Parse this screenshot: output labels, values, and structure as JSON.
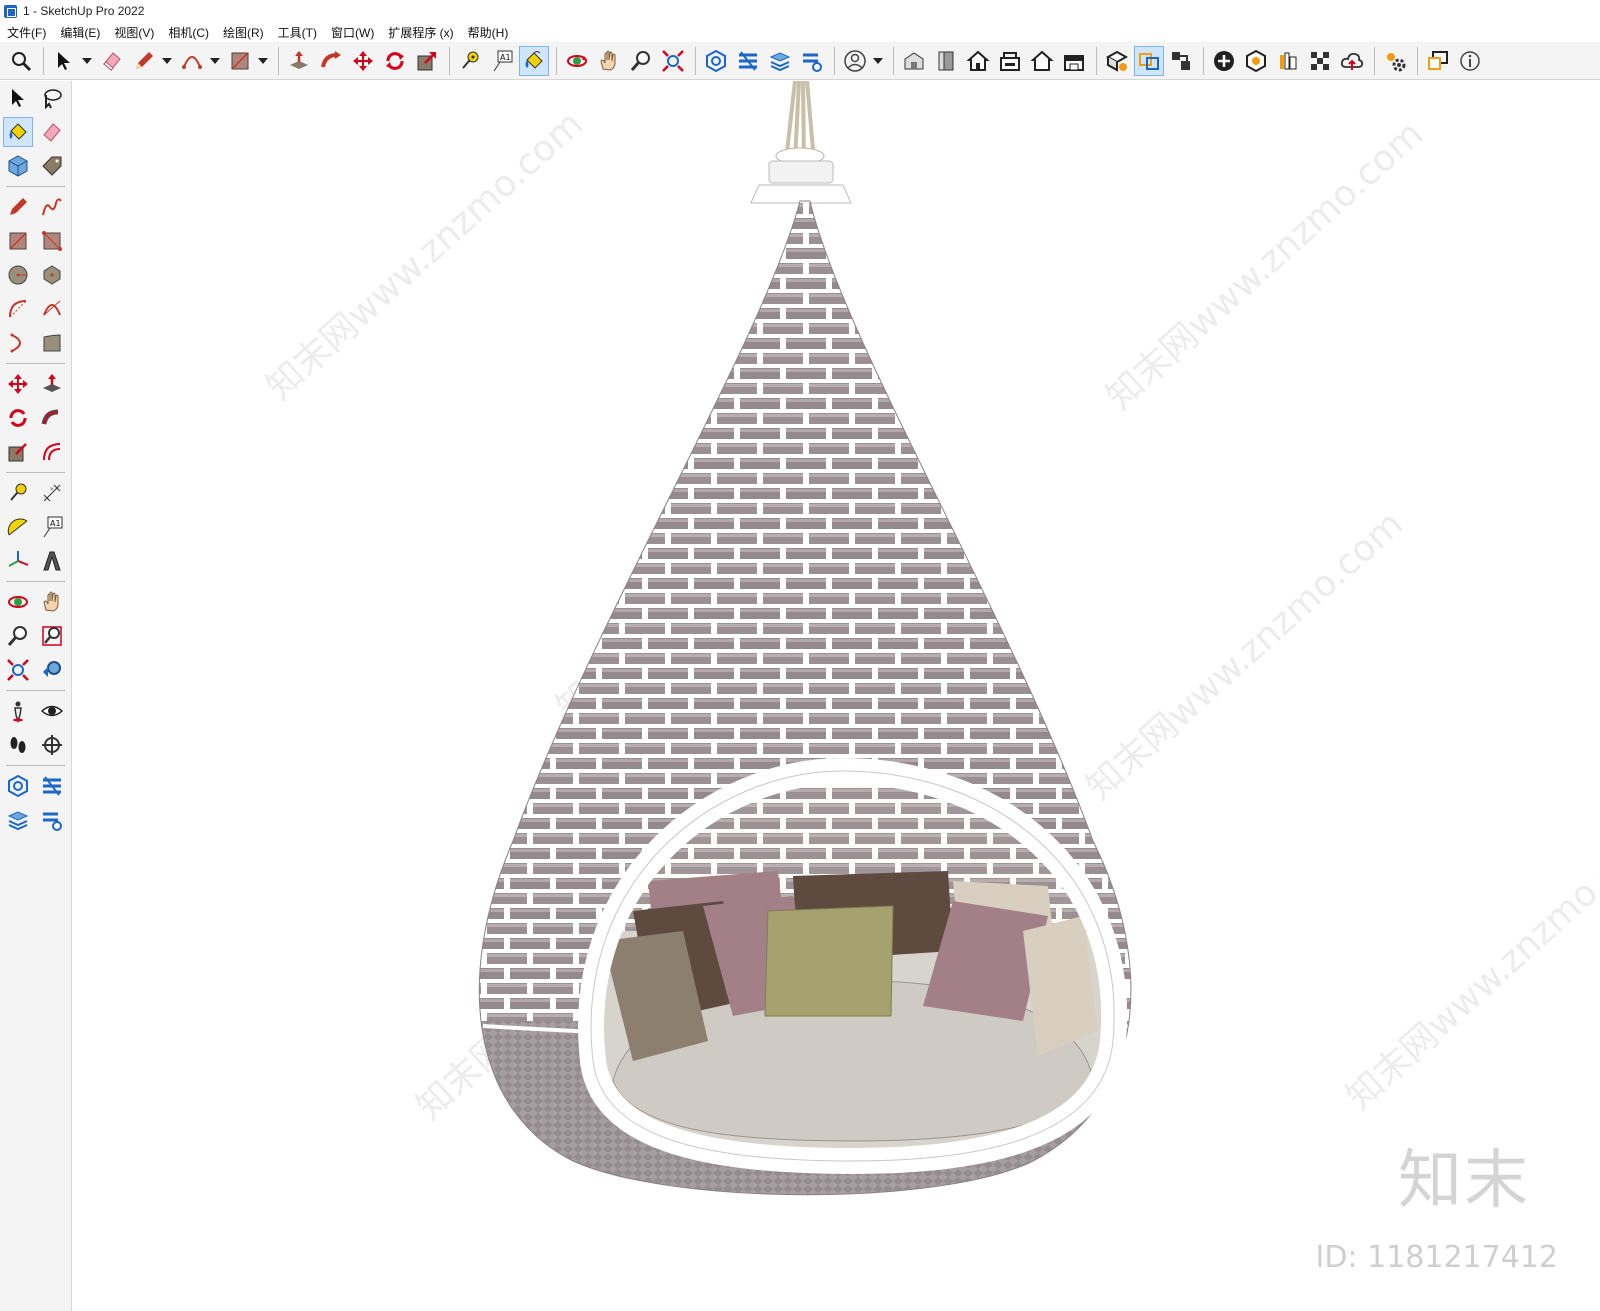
{
  "window": {
    "title": "1 - SketchUp Pro 2022"
  },
  "menu": [
    "文件(F)",
    "编辑(E)",
    "视图(V)",
    "相机(C)",
    "绘图(R)",
    "工具(T)",
    "窗口(W)",
    "扩展程序 (x)",
    "帮助(H)"
  ],
  "toolbar": {
    "text_tool_glyph": "A1",
    "tools": [
      "search-icon",
      "select-icon",
      "eraser-icon",
      "pencil-icon",
      "arc-icon",
      "rectangle-icon",
      "push-pull-icon",
      "follow-me-icon",
      "move-icon",
      "rotate-icon",
      "scale-icon",
      "tape-measure-icon",
      "text-icon",
      "paint-bucket-icon",
      "orbit-icon",
      "pan-icon",
      "zoom-icon",
      "zoom-extents-icon",
      "warehouse-icon",
      "extension-warehouse-icon",
      "layout-icon",
      "extension-manager-icon",
      "account-icon",
      "iso-view-icon",
      "front-view-icon",
      "top-view-icon",
      "right-view-icon",
      "back-view-icon",
      "left-view-icon",
      "section-plane-icon",
      "display-section-icon",
      "section-cuts-icon",
      "solid-tool-icon",
      "outer-shell-icon",
      "styles-icon",
      "xray-icon",
      "cloud-icon",
      "settings-icon",
      "dialog-icon",
      "info-icon"
    ],
    "active_tool": "paint-bucket-icon"
  },
  "palette": {
    "text_tool_glyph": "A1",
    "active_tool": "paint-bucket-icon"
  },
  "viewport": {
    "model": "hanging-pod-chair",
    "watermark_logo": "知末",
    "watermark_id": "ID: 1181217412",
    "watermark_text": "知末网www.znzmo.com"
  },
  "colors": {
    "weave": "#9a8f93",
    "weave_light": "#b8adb0",
    "rim": "#ffffff",
    "cushion_base": "#cfcbc4",
    "pillow_mauve": "#a37f87",
    "pillow_brown": "#5e4a3e",
    "pillow_olive": "#a6a270",
    "pillow_beige": "#d8cfc0",
    "pillow_taupe": "#8c7f70"
  }
}
